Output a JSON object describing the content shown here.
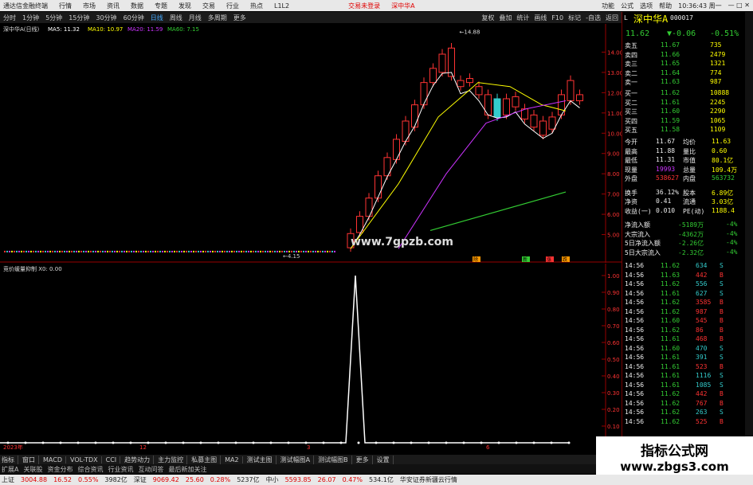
{
  "menubar": {
    "app_title": "通达信金融终端",
    "items": [
      "行情",
      "市场",
      "资讯",
      "数据",
      "专题",
      "发现",
      "交易",
      "行业",
      "热点",
      "L1L2"
    ],
    "alert": "交易未登录",
    "alert2": "深中华A",
    "right": [
      "功能",
      "公式",
      "选项",
      "帮助"
    ],
    "clock": "10:36:43 周一"
  },
  "toolbar": {
    "periods": [
      "分时",
      "1分钟",
      "5分钟",
      "15分钟",
      "30分钟",
      "60分钟",
      "日线",
      "周线",
      "月线",
      "多周期",
      "更多"
    ],
    "active": "日线",
    "right": [
      "复权",
      "叠加",
      "统计",
      "画线",
      "F10",
      "标记",
      "-自选",
      "返回"
    ]
  },
  "chart": {
    "title": "深中华A(日线)",
    "ma": [
      {
        "label": "MA5: 11.32",
        "color": "#ffffff"
      },
      {
        "label": "MA10: 10.97",
        "color": "#ffff00"
      },
      {
        "label": "MA20: 11.59",
        "color": "#cc33ff"
      },
      {
        "label": "MA60: 7.15",
        "color": "#33cc33"
      }
    ],
    "price_ticks": [
      "14.00",
      "13.00",
      "12.00",
      "11.00",
      "10.00",
      "9.00",
      "8.00",
      "7.00",
      "6.00",
      "5.00"
    ],
    "high_label": "14.88",
    "low_label": "4.15",
    "candles": [
      [
        4.35,
        5.05
      ],
      [
        5.1,
        5.9
      ],
      [
        5.9,
        6.8
      ],
      [
        6.8,
        7.9
      ],
      [
        7.9,
        8.8
      ],
      [
        8.7,
        9.7
      ],
      [
        9.6,
        10.6
      ],
      [
        10.3,
        11.4
      ],
      [
        11.4,
        12.5
      ],
      [
        12.5,
        13.2
      ],
      [
        13.0,
        13.9
      ],
      [
        12.8,
        14.2
      ],
      [
        12.3,
        12.6
      ],
      [
        12.5,
        12.7
      ],
      [
        11.9,
        12.3
      ],
      [
        10.9,
        11.9
      ],
      [
        11.7,
        10.8
      ],
      [
        10.9,
        11.7
      ],
      [
        11.3,
        11.8
      ],
      [
        10.7,
        11.2
      ],
      [
        10.3,
        10.9
      ],
      [
        9.9,
        10.6
      ],
      [
        10.2,
        10.8
      ],
      [
        10.9,
        11.9
      ],
      [
        11.6,
        12.6
      ],
      [
        11.6,
        11.9
      ]
    ],
    "ma60": [
      [
        5.2,
        5.4
      ],
      [
        7.1,
        7.1
      ]
    ],
    "labels": [
      "除",
      "新",
      "涨",
      "跌"
    ]
  },
  "sub": {
    "title": "竞价缓量抑制 X0: 0.00",
    "ticks": [
      "1.00",
      "0.90",
      "0.80",
      "0.70",
      "0.60",
      "0.50",
      "0.40",
      "0.30",
      "0.20",
      "0.10",
      "0.00"
    ],
    "xlabels": [
      "2023年",
      "12",
      "3",
      "6"
    ]
  },
  "quote": {
    "name": "深中华A",
    "code": "000017",
    "price": "11.62",
    "change": "▼-0.06",
    "pct": "-0.51%",
    "asks": [
      [
        "卖五",
        "11.67",
        "735"
      ],
      [
        "卖四",
        "11.66",
        "2479"
      ],
      [
        "卖三",
        "11.65",
        "1321"
      ],
      [
        "卖二",
        "11.64",
        "774"
      ],
      [
        "卖一",
        "11.63",
        "987"
      ]
    ],
    "bids": [
      [
        "买一",
        "11.62",
        "10888"
      ],
      [
        "买二",
        "11.61",
        "2245"
      ],
      [
        "买三",
        "11.60",
        "2290"
      ],
      [
        "买四",
        "11.59",
        "1065"
      ],
      [
        "买五",
        "11.58",
        "1109"
      ]
    ],
    "stats": [
      [
        "今开",
        "11.67",
        "均价",
        "11.63"
      ],
      [
        "最高",
        "11.88",
        "量比",
        "0.60"
      ],
      [
        "最低",
        "11.31",
        "市值",
        "80.1亿"
      ],
      [
        "现量",
        "19993",
        "总量",
        "109.4万"
      ],
      [
        "外盘",
        "538627",
        "内盘",
        "563732"
      ],
      [
        "换手",
        "36.12%",
        "股本",
        "6.89亿"
      ],
      [
        "净资",
        "0.41",
        "流通",
        "3.03亿"
      ],
      [
        "收益(一)",
        "0.010",
        "PE(动)",
        "1188.4"
      ]
    ],
    "flows": [
      [
        "净流入额",
        "-5189万",
        "-4%"
      ],
      [
        "大宗流入",
        "-4362万",
        "-4%"
      ],
      [
        "5日净流入额",
        "-2.26亿",
        "-4%"
      ],
      [
        "5日大宗流入",
        "-2.32亿",
        "-4%"
      ]
    ],
    "ticks": [
      [
        "14:56",
        "11.62",
        "634",
        "S"
      ],
      [
        "14:56",
        "11.63",
        "442",
        "B"
      ],
      [
        "14:56",
        "11.62",
        "556",
        "S"
      ],
      [
        "14:56",
        "11.61",
        "627",
        "S"
      ],
      [
        "14:56",
        "11.62",
        "3585",
        "B"
      ],
      [
        "14:56",
        "11.62",
        "987",
        "B"
      ],
      [
        "14:56",
        "11.60",
        "545",
        "B"
      ],
      [
        "14:56",
        "11.62",
        "86",
        "B"
      ],
      [
        "14:56",
        "11.61",
        "468",
        "B"
      ],
      [
        "14:56",
        "11.60",
        "470",
        "S"
      ],
      [
        "14:56",
        "11.61",
        "391",
        "S"
      ],
      [
        "14:56",
        "11.61",
        "523",
        "B"
      ],
      [
        "14:56",
        "11.61",
        "1116",
        "S"
      ],
      [
        "14:56",
        "11.61",
        "1085",
        "S"
      ],
      [
        "14:56",
        "11.62",
        "442",
        "B"
      ],
      [
        "14:56",
        "11.62",
        "767",
        "B"
      ],
      [
        "14:56",
        "11.62",
        "263",
        "S"
      ],
      [
        "14:56",
        "11.62",
        "525",
        "B"
      ]
    ]
  },
  "bottom": {
    "tabs": [
      "指标",
      "窗口",
      "MACD",
      "VOL-TDX",
      "CCI",
      "趋势动力",
      "主力监控",
      "私募主图",
      "MA2",
      "测试主图",
      "测试幅图A",
      "测试幅图B",
      "更多",
      "设置"
    ],
    "tabs2": [
      "扩展A",
      "关联股",
      "资金分布",
      "综合资讯",
      "行业资讯",
      "互动问答",
      "最后新加关注"
    ],
    "right": "模板"
  },
  "status": {
    "items": [
      [
        "上证",
        "3004.88",
        "16.52",
        "0.55%",
        "3982亿"
      ],
      [
        "深证",
        "9069.42",
        "25.60",
        "0.28%",
        "5237亿"
      ],
      [
        "中小",
        "5593.85",
        "26.07",
        "0.47%",
        "534.1亿"
      ]
    ],
    "broker": "华安证券新疆云行情"
  },
  "watermark": "www.7gpzb.com",
  "banner": {
    "line1": "指标公式网",
    "line2": "www.zbgs3.com"
  }
}
